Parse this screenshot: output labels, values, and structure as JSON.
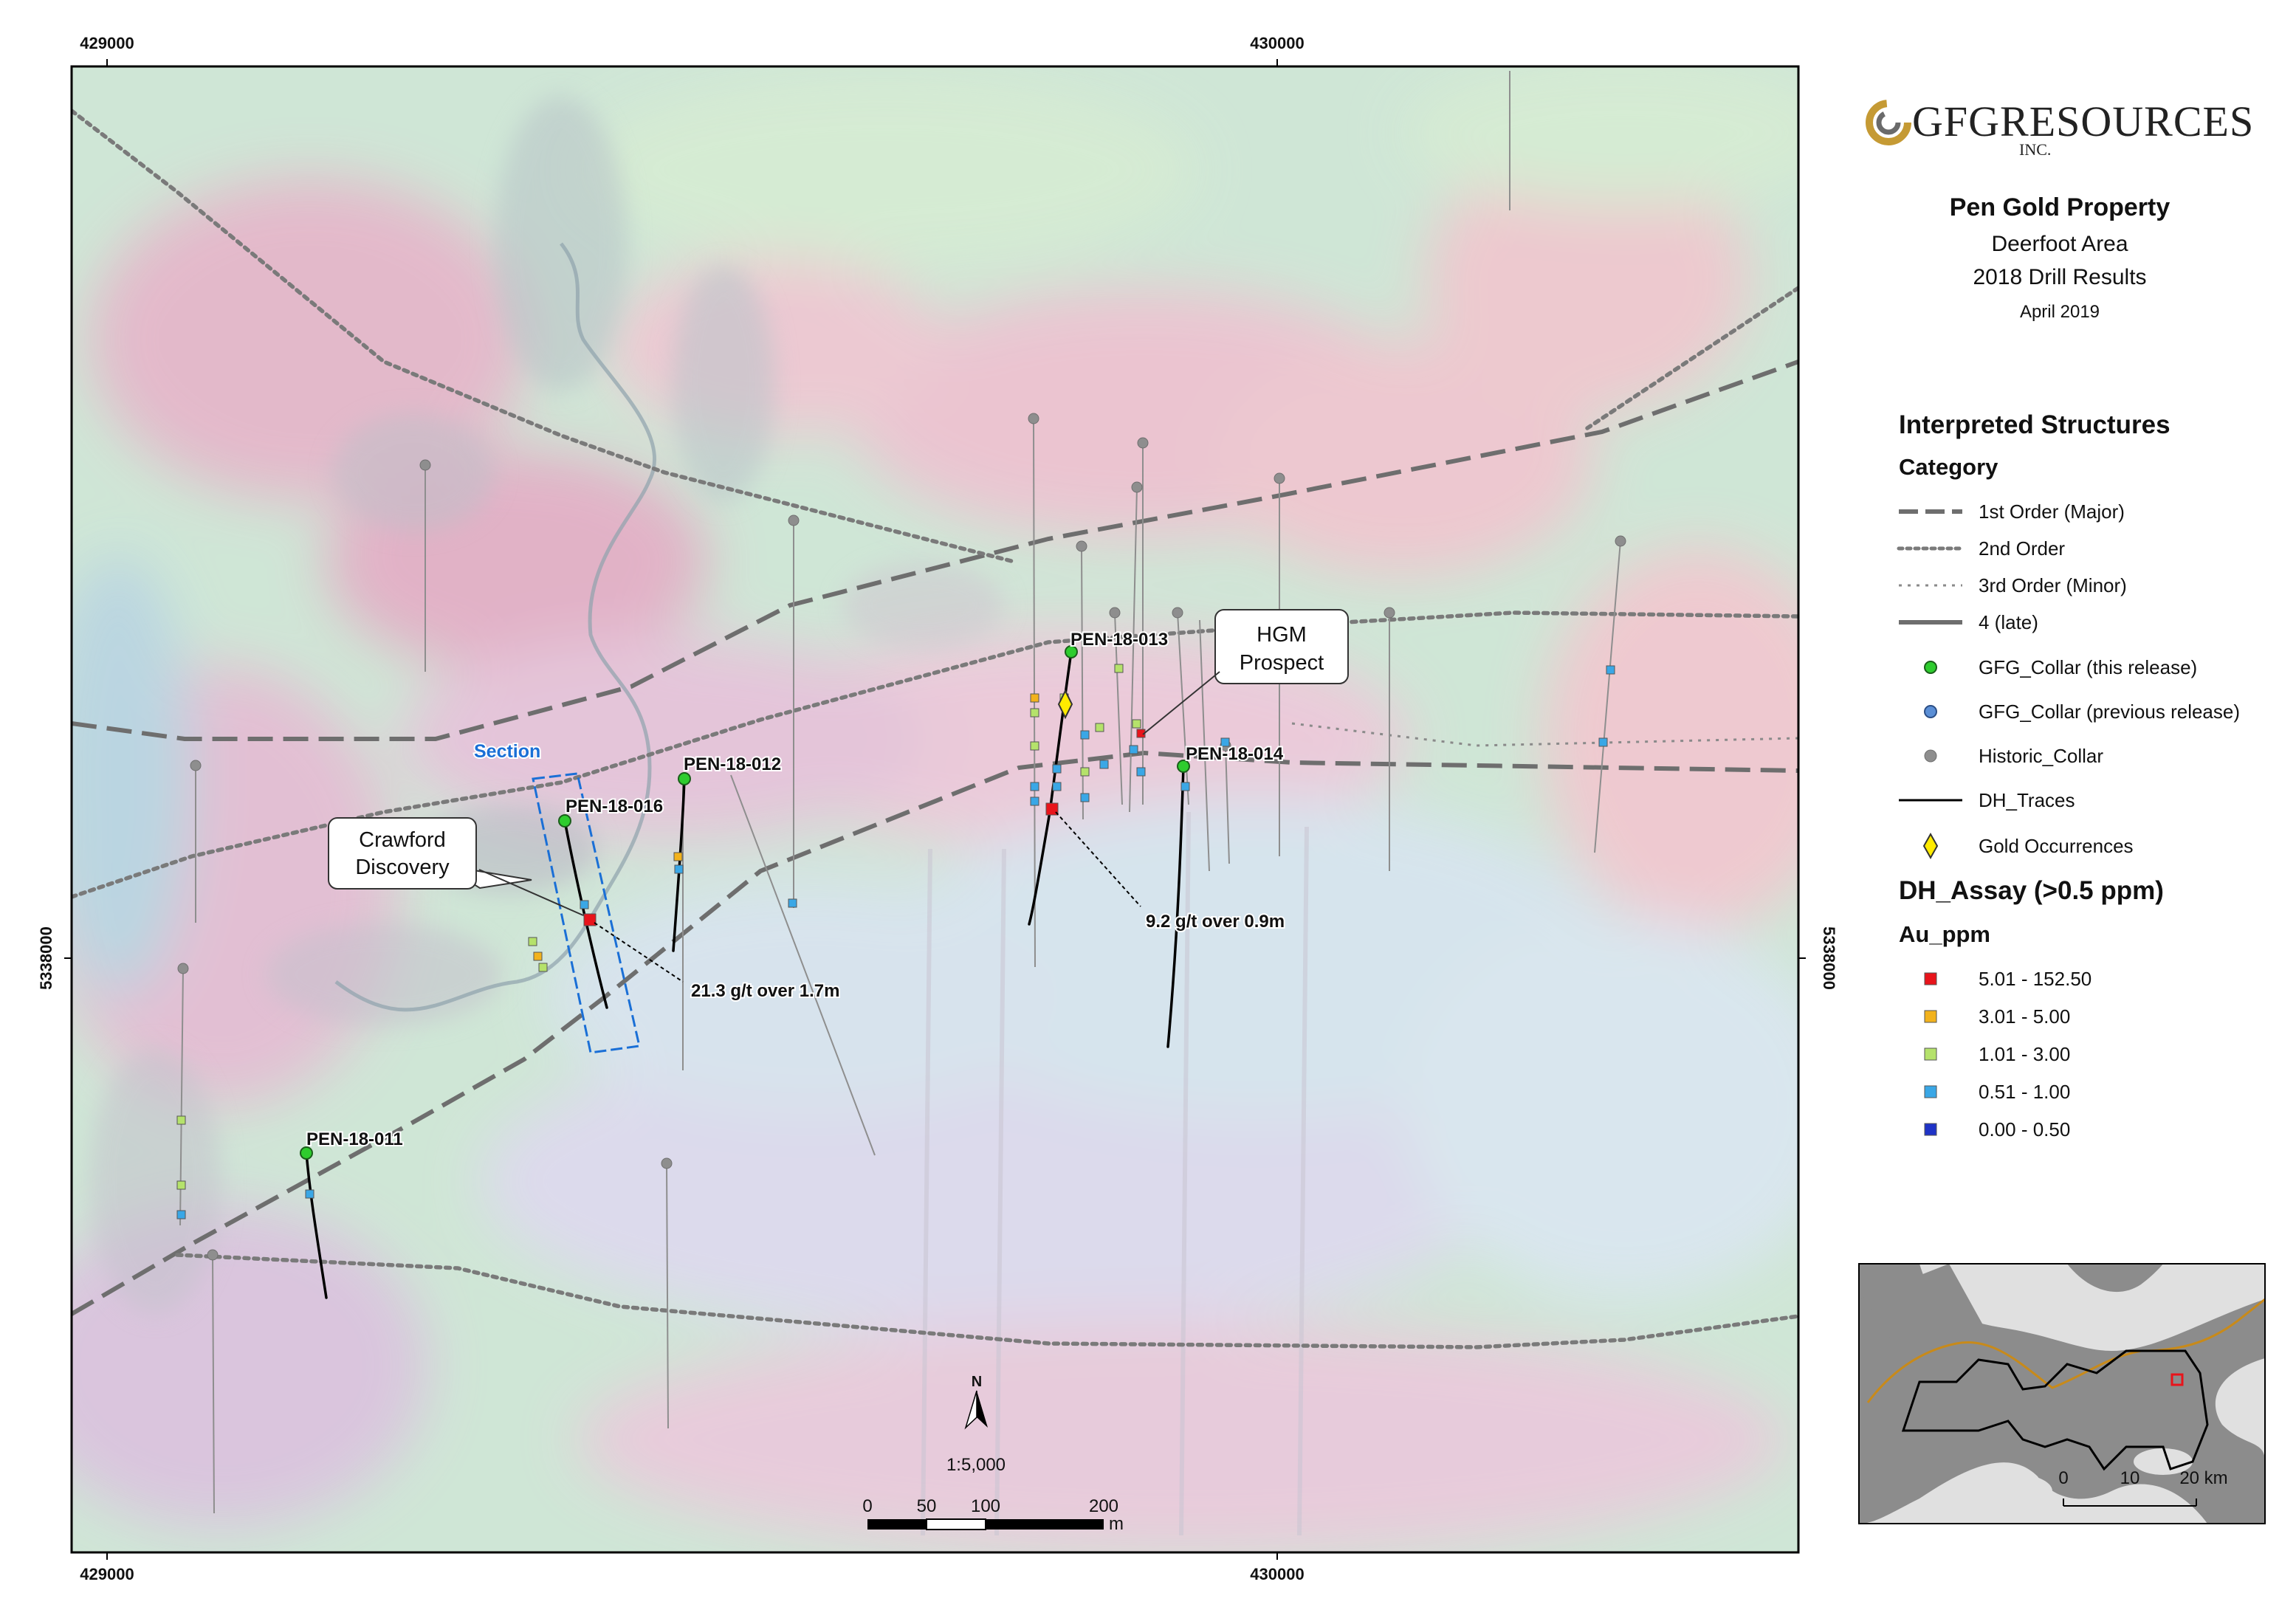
{
  "map": {
    "easting_labels": [
      "429000",
      "430000"
    ],
    "northing_label": "5338000",
    "section_label": "Section",
    "callouts": {
      "crawford": [
        "Crawford",
        "Discovery"
      ],
      "hgm": [
        "HGM",
        "Prospect"
      ]
    },
    "drillholes": [
      "PEN-18-011",
      "PEN-18-012",
      "PEN-18-013",
      "PEN-18-014",
      "PEN-18-016"
    ],
    "intercepts": [
      "21.3 g/t over 1.7m",
      "9.2 g/t over 0.9m"
    ],
    "north_label": "N",
    "scale_ratio": "1:5,000",
    "scale_ticks": [
      "0",
      "50",
      "100",
      "200"
    ],
    "scale_unit": "m"
  },
  "logo": {
    "name": "GFGRESOURCES",
    "suffix": "INC."
  },
  "title": {
    "property": "Pen Gold Property",
    "area": "Deerfoot Area",
    "subject": "2018 Drill Results",
    "date": "April 2019"
  },
  "legend": {
    "structures_title": "Interpreted Structures",
    "category_title": "Category",
    "structures": [
      "1st Order (Major)",
      "2nd Order",
      "3rd Order (Minor)",
      "4 (late)"
    ],
    "points": [
      "GFG_Collar (this release)",
      "GFG_Collar (previous release)",
      "Historic_Collar",
      "DH_Traces",
      "Gold Occurrences"
    ],
    "assay_title": "DH_Assay (>0.5 ppm)",
    "assay_field": "Au_ppm",
    "assay_classes": [
      {
        "label": "5.01 - 152.50",
        "color": "#e8141b"
      },
      {
        "label": "3.01 - 5.00",
        "color": "#f2b21c"
      },
      {
        "label": "1.01 - 3.00",
        "color": "#b5e26b"
      },
      {
        "label": "0.51 - 1.00",
        "color": "#3aa7e6"
      },
      {
        "label": "0.00 - 0.50",
        "color": "#1f33c7"
      }
    ]
  },
  "inset": {
    "ticks": [
      "0",
      "10",
      "20 km"
    ]
  },
  "colors": {
    "collar_this_release": "#2ecc2e",
    "collar_previous_release": "#5b8fd6",
    "historic_collar": "#8e8e8e",
    "gold_occurrence": "#ffeb00",
    "section_box": "#1a6fd6",
    "structure": "#6e6e6e"
  }
}
